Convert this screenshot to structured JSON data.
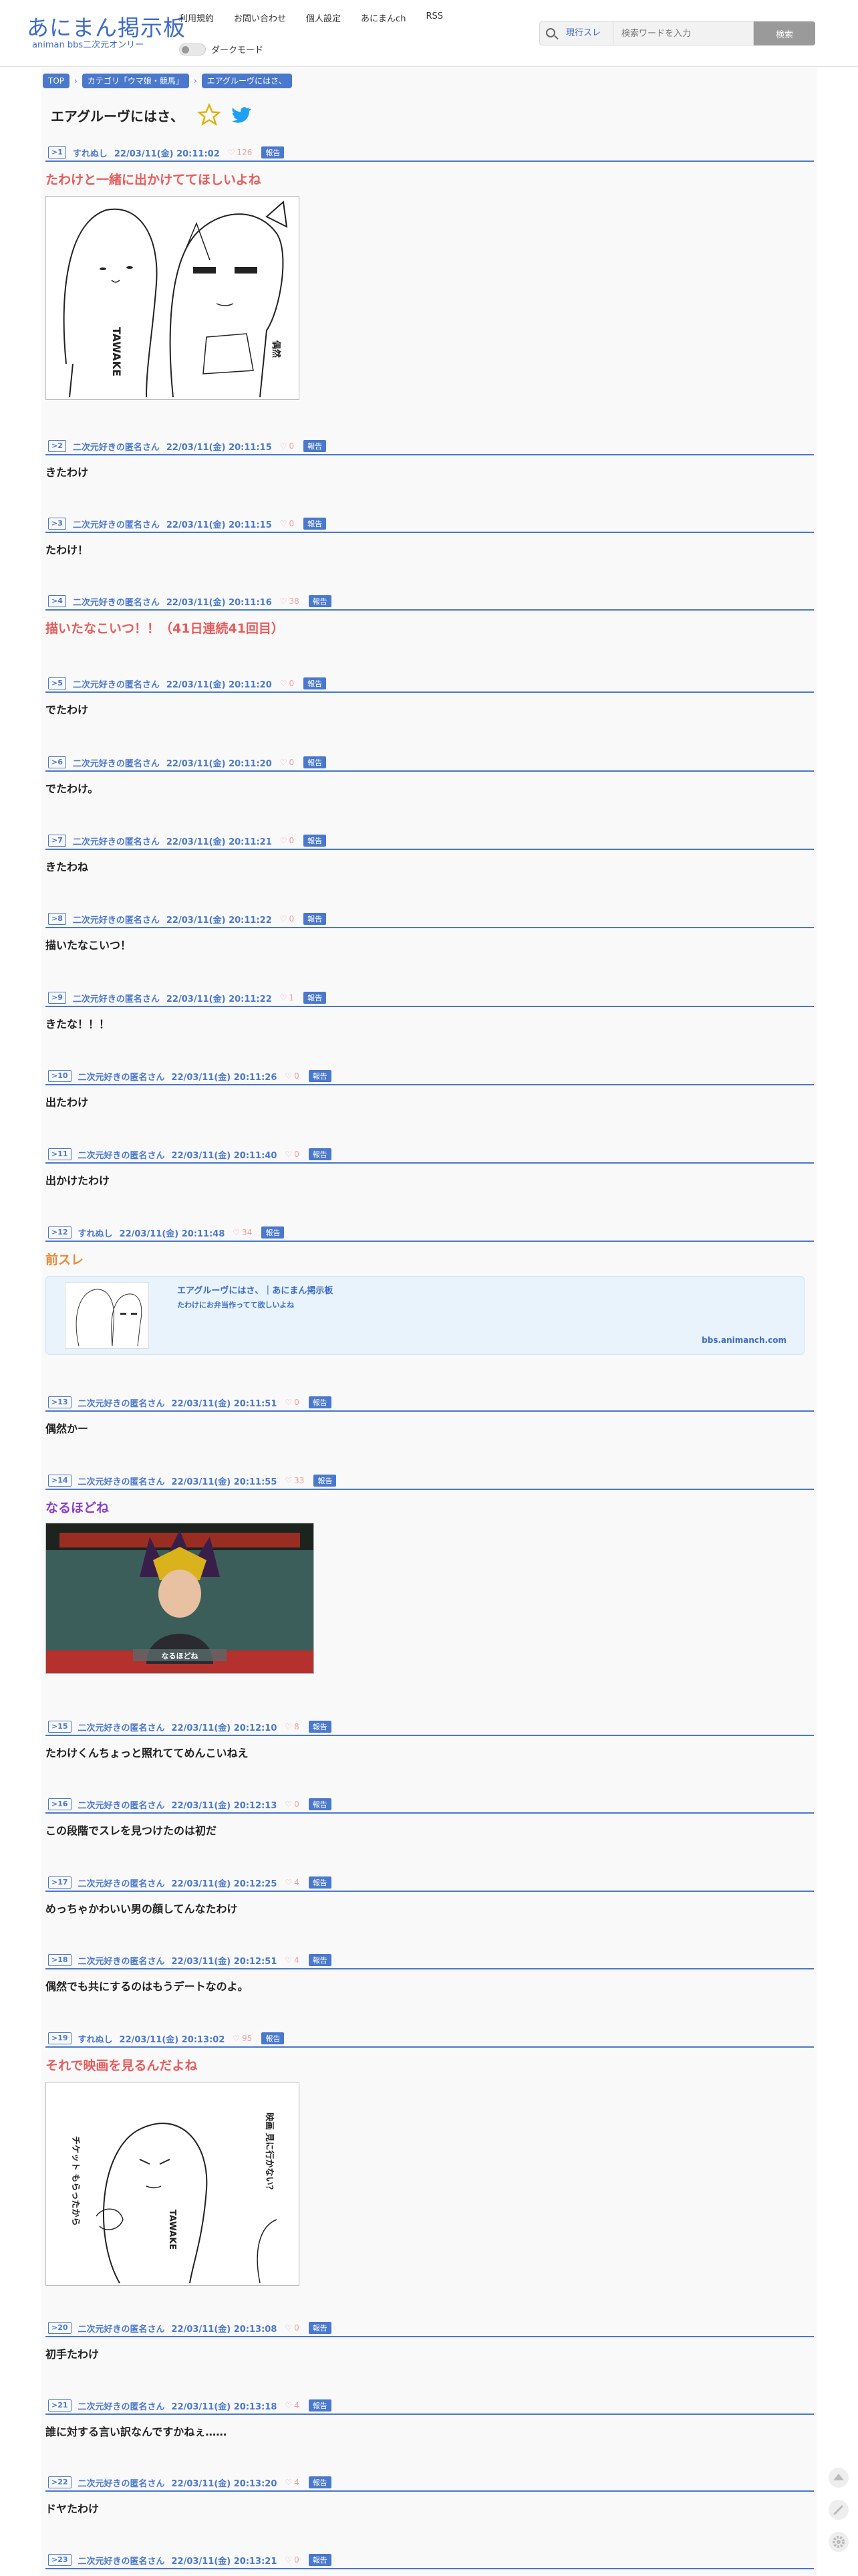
{
  "header": {
    "logo_main": "あにまん掲示板",
    "logo_sub": "animan bbs二次元オンリー",
    "nav": [
      "利用規約",
      "お問い合わせ",
      "個人設定",
      "あにまんch",
      "RSS"
    ],
    "darkmode_label": "ダークモード",
    "search": {
      "scope": "現行スレ",
      "placeholder": "検索ワードを入力",
      "button": "検索"
    }
  },
  "breadcrumb": [
    "TOP",
    "カテゴリ「ウマ娘・競馬」",
    "エアグルーヴにはさ、"
  ],
  "thread_title": "エアグルーヴにはさ、",
  "report_label": "報告",
  "posts": [
    {
      "num": ">1",
      "name": "すれぬし",
      "date": "22/03/11(金) 20:11:02",
      "likes": "126",
      "body": "たわけと一緒に出かけててほしいよね",
      "style": "red",
      "image": "sketch1"
    },
    {
      "num": ">2",
      "name": "二次元好きの匿名さん",
      "date": "22/03/11(金) 20:11:15",
      "likes": "0",
      "body": "きたわけ"
    },
    {
      "num": ">3",
      "name": "二次元好きの匿名さん",
      "date": "22/03/11(金) 20:11:15",
      "likes": "0",
      "body": "たわけ！"
    },
    {
      "num": ">4",
      "name": "二次元好きの匿名さん",
      "date": "22/03/11(金) 20:11:16",
      "likes": "38",
      "body": "描いたなこいつ！！（41日連続41回目）",
      "style": "red"
    },
    {
      "num": ">5",
      "name": "二次元好きの匿名さん",
      "date": "22/03/11(金) 20:11:20",
      "likes": "0",
      "body": "でたわけ"
    },
    {
      "num": ">6",
      "name": "二次元好きの匿名さん",
      "date": "22/03/11(金) 20:11:20",
      "likes": "0",
      "body": "でたわけ。"
    },
    {
      "num": ">7",
      "name": "二次元好きの匿名さん",
      "date": "22/03/11(金) 20:11:21",
      "likes": "0",
      "body": "きたわね"
    },
    {
      "num": ">8",
      "name": "二次元好きの匿名さん",
      "date": "22/03/11(金) 20:11:22",
      "likes": "0",
      "body": "描いたなこいつ！"
    },
    {
      "num": ">9",
      "name": "二次元好きの匿名さん",
      "date": "22/03/11(金) 20:11:22",
      "likes": "1",
      "body": "きたな！！！"
    },
    {
      "num": ">10",
      "name": "二次元好きの匿名さん",
      "date": "22/03/11(金) 20:11:26",
      "likes": "0",
      "body": "出たわけ"
    },
    {
      "num": ">11",
      "name": "二次元好きの匿名さん",
      "date": "22/03/11(金) 20:11:40",
      "likes": "0",
      "body": "出かけたわけ"
    },
    {
      "num": ">12",
      "name": "すれぬし",
      "date": "22/03/11(金) 20:11:48",
      "likes": "34",
      "body": "前スレ",
      "style": "orange",
      "link_card": true
    },
    {
      "num": ">13",
      "name": "二次元好きの匿名さん",
      "date": "22/03/11(金) 20:11:51",
      "likes": "0",
      "body": "偶然かー"
    },
    {
      "num": ">14",
      "name": "二次元好きの匿名さん",
      "date": "22/03/11(金) 20:11:55",
      "likes": "33",
      "body": "なるほどね",
      "style": "purple",
      "image": "screenshot"
    },
    {
      "num": ">15",
      "name": "二次元好きの匿名さん",
      "date": "22/03/11(金) 20:12:10",
      "likes": "8",
      "body": "たわけくんちょっと照れててめんこいねえ"
    },
    {
      "num": ">16",
      "name": "二次元好きの匿名さん",
      "date": "22/03/11(金) 20:12:13",
      "likes": "0",
      "body": "この段階でスレを見つけたのは初だ"
    },
    {
      "num": ">17",
      "name": "二次元好きの匿名さん",
      "date": "22/03/11(金) 20:12:25",
      "likes": "4",
      "body": "めっちゃかわいい男の顔してんなたわけ"
    },
    {
      "num": ">18",
      "name": "二次元好きの匿名さん",
      "date": "22/03/11(金) 20:12:51",
      "likes": "4",
      "body": "偶然でも共にするのはもうデートなのよ。"
    },
    {
      "num": ">19",
      "name": "すれぬし",
      "date": "22/03/11(金) 20:13:02",
      "likes": "95",
      "body": "それで映画を見るんだよね",
      "style": "red",
      "image": "sketch2"
    },
    {
      "num": ">20",
      "name": "二次元好きの匿名さん",
      "date": "22/03/11(金) 20:13:08",
      "likes": "0",
      "body": "初手たわけ"
    },
    {
      "num": ">21",
      "name": "二次元好きの匿名さん",
      "date": "22/03/11(金) 20:13:18",
      "likes": "4",
      "body": "誰に対する言い訳なんですかねぇ……"
    },
    {
      "num": ">22",
      "name": "二次元好きの匿名さん",
      "date": "22/03/11(金) 20:13:20",
      "likes": "4",
      "body": "ドヤたわけ"
    },
    {
      "num": ">23",
      "name": "二次元好きの匿名さん",
      "date": "22/03/11(金) 20:13:21",
      "likes": "0",
      "body": ""
    }
  ],
  "link_card": {
    "title": "エアグルーヴにはさ、｜あにまん掲示板",
    "desc": "たわけにお弁当作ってて欲しいよね",
    "domain": "bbs.animanch.com"
  },
  "sketch1_text": {
    "left": "TAWAKE",
    "right": "偶然"
  },
  "sketch2_text": {
    "left": "チケット もらったから",
    "right": "映画 見に行かない？",
    "label": "TAWAKE"
  },
  "screenshot_caption": "なるほどね"
}
